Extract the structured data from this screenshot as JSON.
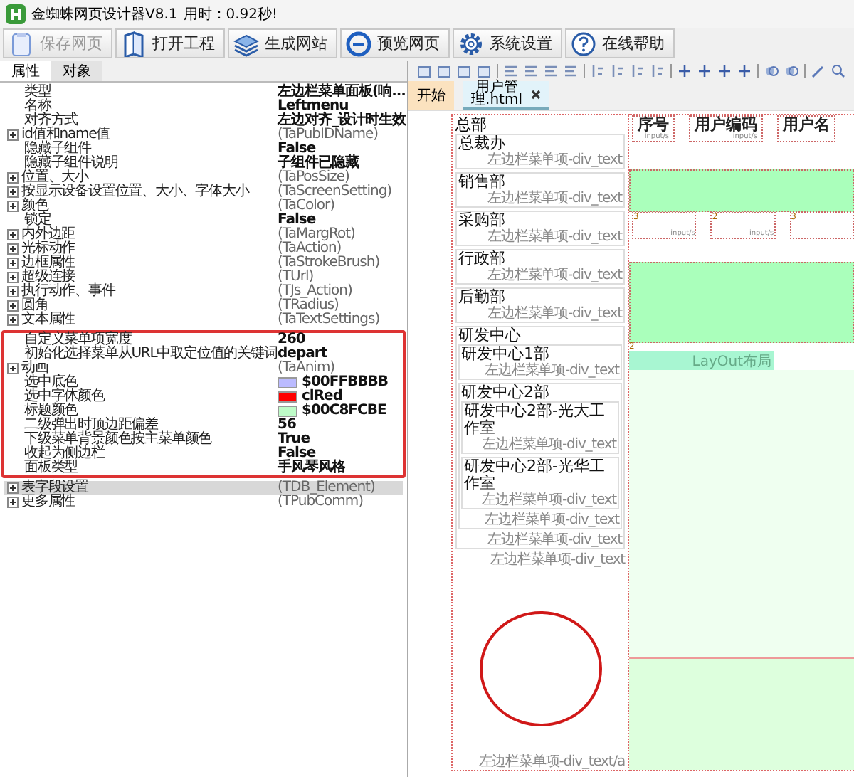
{
  "window": {
    "title": "金蜘蛛网页设计器V8.1",
    "elapsed": "用时：0.92秒!"
  },
  "toolbar": [
    {
      "label": "保存网页",
      "disabled": true
    },
    {
      "label": "打开工程",
      "disabled": false
    },
    {
      "label": "生成网站",
      "disabled": false
    },
    {
      "label": "预览网页",
      "disabled": false
    },
    {
      "label": "系统设置",
      "disabled": false
    },
    {
      "label": "在线帮助",
      "disabled": false
    }
  ],
  "panel_tabs": [
    {
      "label": "属性",
      "selected": true
    },
    {
      "label": "对象",
      "selected": false
    }
  ],
  "properties": [
    {
      "highlighted": false,
      "rows": [
        {
          "name": "类型",
          "value": "左边栏菜单面板(响...",
          "kind": "plain",
          "selected": false
        },
        {
          "name": "名称",
          "value": "Leftmenu",
          "kind": "plain",
          "selected": false
        },
        {
          "name": "对齐方式",
          "value": "左边对齐_设计时生效",
          "kind": "plain",
          "selected": false
        },
        {
          "name": "id值和name值",
          "value": "(TaPubIDName)",
          "kind": "group",
          "expanded": false,
          "selected": false
        },
        {
          "name": "隐藏子组件",
          "value": "False",
          "kind": "plain",
          "selected": false
        },
        {
          "name": "隐藏子组件说明",
          "value": "子组件已隐藏",
          "kind": "plain",
          "selected": false
        },
        {
          "name": "位置、大小",
          "value": "(TaPosSize)",
          "kind": "group",
          "expanded": false,
          "selected": false
        },
        {
          "name": "按显示设备设置位置、大小、字体大小",
          "value": "(TaScreenSetting)",
          "kind": "group",
          "expanded": false,
          "selected": false
        },
        {
          "name": "颜色",
          "value": "(TaColor)",
          "kind": "group",
          "expanded": false,
          "selected": false
        },
        {
          "name": "锁定",
          "value": "False",
          "kind": "plain",
          "selected": false
        },
        {
          "name": "内外边距",
          "value": "(TaMargRot)",
          "kind": "group",
          "expanded": false,
          "selected": false
        },
        {
          "name": "光标动作",
          "value": "(TaAction)",
          "kind": "group",
          "expanded": false,
          "selected": false
        },
        {
          "name": "边框属性",
          "value": "(TaStrokeBrush)",
          "kind": "group",
          "expanded": false,
          "selected": false
        },
        {
          "name": "超级连接",
          "value": "(TUrl)",
          "kind": "group",
          "expanded": false,
          "selected": false
        },
        {
          "name": "执行动作、事件",
          "value": "(TJs_Action)",
          "kind": "group",
          "expanded": false,
          "selected": false
        },
        {
          "name": "圆角",
          "value": "(TRadius)",
          "kind": "group",
          "expanded": false,
          "selected": false
        },
        {
          "name": "文本属性",
          "value": "(TaTextSettings)",
          "kind": "group",
          "expanded": false,
          "selected": false
        }
      ]
    },
    {
      "highlighted": true,
      "rows": [
        {
          "name": "自定义菜单项宽度",
          "value": "260",
          "kind": "plain",
          "selected": false
        },
        {
          "name": "初始化选择菜单从URL中取定位值的关键词",
          "value": "depart",
          "kind": "plain",
          "selected": false
        },
        {
          "name": "动画",
          "value": "(TaAnim)",
          "kind": "group",
          "expanded": false,
          "selected": false
        },
        {
          "name": "选中底色",
          "value": "$00FFBBBB",
          "kind": "color",
          "color": "#bbbbff",
          "selected": false
        },
        {
          "name": "选中字体颜色",
          "value": "clRed",
          "kind": "color",
          "color": "#ff0000",
          "selected": false
        },
        {
          "name": "标题颜色",
          "value": "$00C8FCBE",
          "kind": "color",
          "color": "#befcc8",
          "selected": false
        },
        {
          "name": "二级弹出时顶边距偏差",
          "value": "56",
          "kind": "plain",
          "selected": false
        },
        {
          "name": "下级菜单背景颜色按主菜单颜色",
          "value": "True",
          "kind": "plain",
          "selected": false
        },
        {
          "name": "收起为侧边栏",
          "value": "False",
          "kind": "plain",
          "selected": false
        },
        {
          "name": "面板类型",
          "value": "手风琴风格",
          "kind": "plain",
          "selected": false
        }
      ]
    },
    {
      "highlighted": false,
      "rows": [
        {
          "name": "表字段设置",
          "value": "(TDB_Element)",
          "kind": "group",
          "expanded": false,
          "selected": true
        },
        {
          "name": "更多属性",
          "value": "(TPubComm)",
          "kind": "group",
          "expanded": false,
          "selected": false
        }
      ]
    }
  ],
  "designer": {
    "tabs": [
      {
        "label": "开始",
        "kind": "home",
        "selected": false
      },
      {
        "label": "用户管理.html",
        "kind": "file",
        "selected": true
      }
    ],
    "menu": {
      "title": "总部",
      "items": [
        {
          "label": "总裁办",
          "caption": "左边栏菜单项-div_text"
        },
        {
          "label": "销售部",
          "caption": "左边栏菜单项-div_text"
        },
        {
          "label": "采购部",
          "caption": "左边栏菜单项-div_text"
        },
        {
          "label": "行政部",
          "caption": "左边栏菜单项-div_text"
        },
        {
          "label": "后勤部",
          "caption": "左边栏菜单项-div_text"
        },
        {
          "label": "研发中心",
          "caption": "左边栏菜单项-div_text",
          "children": [
            {
              "label": "研发中心1部",
              "caption": "左边栏菜单项-div_text"
            },
            {
              "label": "研发中心2部",
              "caption": "左边栏菜单项-div_text",
              "children": [
                {
                  "label": "研发中心2部-光大工作室",
                  "caption": "左边栏菜单项-div_text"
                },
                {
                  "label": "研发中心2部-光华工作室",
                  "caption": "左边栏菜单项-div_text"
                }
              ]
            }
          ]
        }
      ],
      "footer_captions": [
        "左边栏菜单项-div_text",
        "左边栏菜单项-div_text/a"
      ]
    },
    "table": {
      "columns": [
        {
          "label": "序号",
          "hint": "input/s"
        },
        {
          "label": "用户编码",
          "hint": "input/s"
        },
        {
          "label": "用户名"
        }
      ],
      "cells": [
        {
          "index": "3",
          "hint": "input/s"
        },
        {
          "index": "2",
          "hint": "input/s"
        },
        {
          "index": "3"
        }
      ]
    },
    "layout": {
      "index": "2",
      "label": "LayOut布局"
    }
  }
}
